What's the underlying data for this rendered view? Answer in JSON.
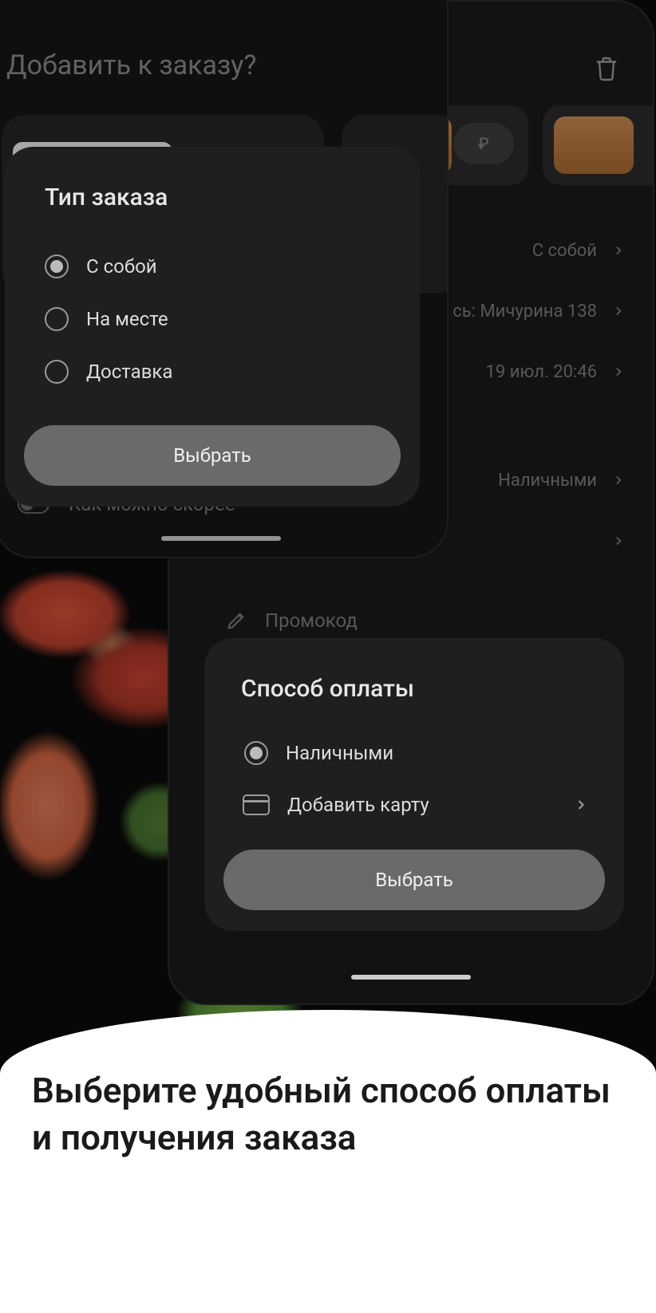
{
  "front": {
    "addToOrder": "Добавить к заказу?",
    "asap": "Как можно скорее"
  },
  "back": {
    "priceSymbol": "₽",
    "rows": {
      "takeaway": "С собой",
      "address": "сь: Мичурина 138",
      "datetime": "19 июл. 20:46",
      "payment": "Наличными"
    },
    "promo": "Промокод"
  },
  "orderTypeModal": {
    "title": "Тип заказа",
    "options": {
      "takeaway": "С собой",
      "onsite": "На месте",
      "delivery": "Доставка"
    },
    "selectBtn": "Выбрать"
  },
  "paymentModal": {
    "title": "Способ оплаты",
    "cash": "Наличными",
    "addCard": "Добавить карту",
    "selectBtn": "Выбрать"
  },
  "bottomHeadline": "Выберите удобный способ оплаты и получения заказа"
}
